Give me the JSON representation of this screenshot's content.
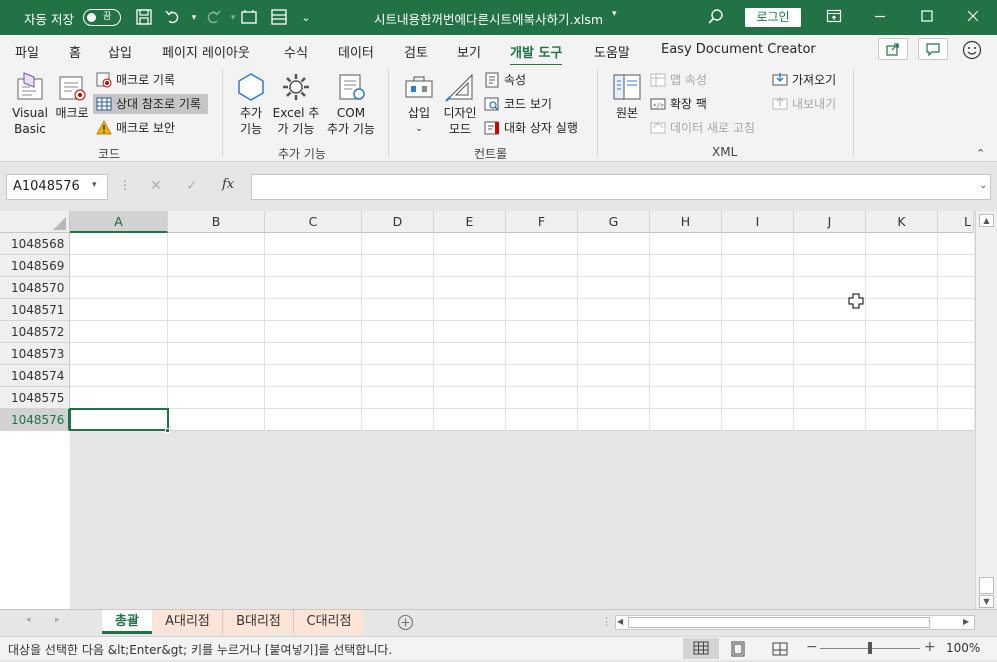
{
  "titlebar": {
    "autosave_label": "자동 저장",
    "autosave_state": "끔",
    "filename": "시트내용한꺼번에다른시트에복사하기.xlsm",
    "login": "로그인"
  },
  "ribbon_tabs": [
    "파일",
    "홈",
    "삽입",
    "페이지 레이아웃",
    "수식",
    "데이터",
    "검토",
    "보기",
    "개발 도구",
    "도움말",
    "Easy Document Creator"
  ],
  "ribbon": {
    "code": {
      "label": "코드",
      "visual_basic_1": "Visual",
      "visual_basic_2": "Basic",
      "macro": "매크로",
      "record": "매크로 기록",
      "relative": "상대 참조로 기록",
      "security": "매크로 보안"
    },
    "addins": {
      "label": "추가 기능",
      "addin_1": "추가",
      "addin_2": "기능",
      "excel_1": "Excel 추",
      "excel_2": "가 기능",
      "com_1": "COM",
      "com_2": "추가 기능"
    },
    "controls": {
      "label": "컨트롤",
      "insert": "삽입",
      "design_1": "디자인",
      "design_2": "모드",
      "properties": "속성",
      "view_code": "코드 보기",
      "dialog": "대화 상자 실행"
    },
    "xml": {
      "label": "XML",
      "source": "원본",
      "map_props": "맵 속성",
      "expansion": "확장 팩",
      "refresh": "데이터 새로 고침",
      "import": "가져오기",
      "export": "내보내기"
    }
  },
  "formula_bar": {
    "name_box": "A1048576",
    "fx": "fx",
    "value": ""
  },
  "columns": [
    "A",
    "B",
    "C",
    "D",
    "E",
    "F",
    "G",
    "H",
    "I",
    "J",
    "K",
    "L"
  ],
  "rows": [
    "1048568",
    "1048569",
    "1048570",
    "1048571",
    "1048572",
    "1048573",
    "1048574",
    "1048575",
    "1048576"
  ],
  "sheets": [
    "총괄",
    "A대리점",
    "B대리점",
    "C대리점"
  ],
  "status": {
    "message": "대상을 선택한 다음 &lt;Enter&gt; 키를 누르거나 [붙여넣기]를 선택합니다.",
    "zoom": "100%"
  },
  "colors": {
    "accent": "#217346",
    "sheet_tab": "#fce4d6"
  }
}
